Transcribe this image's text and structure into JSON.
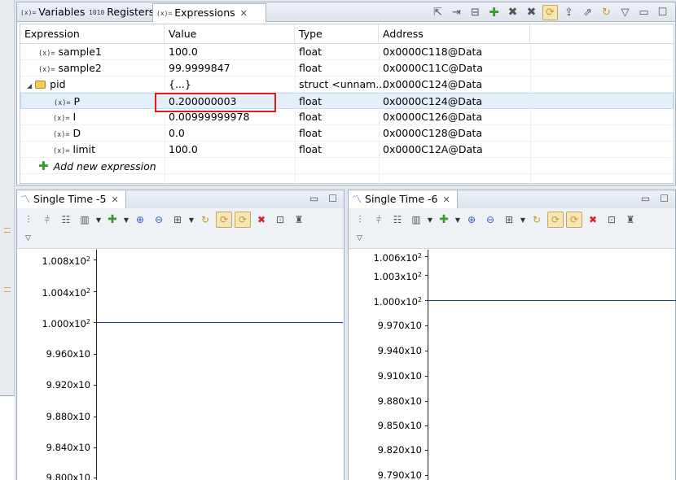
{
  "tabs": [
    {
      "icon": "(x)=",
      "label": "Variables"
    },
    {
      "icon": "1010",
      "label": "Registers"
    },
    {
      "icon": "(x)=",
      "label": "Expressions"
    }
  ],
  "table": {
    "headers": [
      "Expression",
      "Value",
      "Type",
      "Address"
    ],
    "rows": [
      {
        "name": "sample1",
        "value": "100.0",
        "type": "float",
        "address": "0x0000C118@Data"
      },
      {
        "name": "sample2",
        "value": "99.9999847",
        "type": "float",
        "address": "0x0000C11C@Data"
      },
      {
        "name": "pid",
        "value": "{...}",
        "type": "struct <unnam...",
        "address": "0x0000C124@Data"
      },
      {
        "name": "P",
        "value": "0.200000003",
        "type": "float",
        "address": "0x0000C124@Data"
      },
      {
        "name": "I",
        "value": "0.00999999978",
        "type": "float",
        "address": "0x0000C126@Data"
      },
      {
        "name": "D",
        "value": "0.0",
        "type": "float",
        "address": "0x0000C128@Data"
      },
      {
        "name": "limit",
        "value": "100.0",
        "type": "float",
        "address": "0x0000C12A@Data"
      }
    ],
    "add_label": "Add new expression",
    "var_icon": "(x)="
  },
  "graph1": {
    "title": "Single Time -5",
    "ticks": [
      "1.008x10",
      "1.004x10",
      "1.000x10",
      "9.960x10",
      "9.920x10",
      "9.880x10",
      "9.840x10",
      "9.800x10"
    ],
    "sup": "2"
  },
  "graph2": {
    "title": "Single Time -6",
    "ticks": [
      "1.006x10",
      "1.003x10",
      "1.000x10",
      "9.970x10",
      "9.940x10",
      "9.910x10",
      "9.880x10",
      "9.850x10",
      "9.820x10",
      "9.790x10"
    ],
    "sup": "2"
  },
  "chart_data": [
    {
      "type": "line",
      "title": "Single Time -5",
      "ylim": [
        98.0,
        100.8
      ],
      "series": [
        {
          "values": [
            100.0,
            100.0
          ]
        }
      ]
    },
    {
      "type": "line",
      "title": "Single Time -6",
      "ylim": [
        97.9,
        100.6
      ],
      "series": [
        {
          "values": [
            100.0,
            100.0
          ]
        }
      ]
    }
  ],
  "colors": {
    "series": "#1a2fae",
    "highlight": "#e0191b",
    "selection": "#e4effc"
  }
}
